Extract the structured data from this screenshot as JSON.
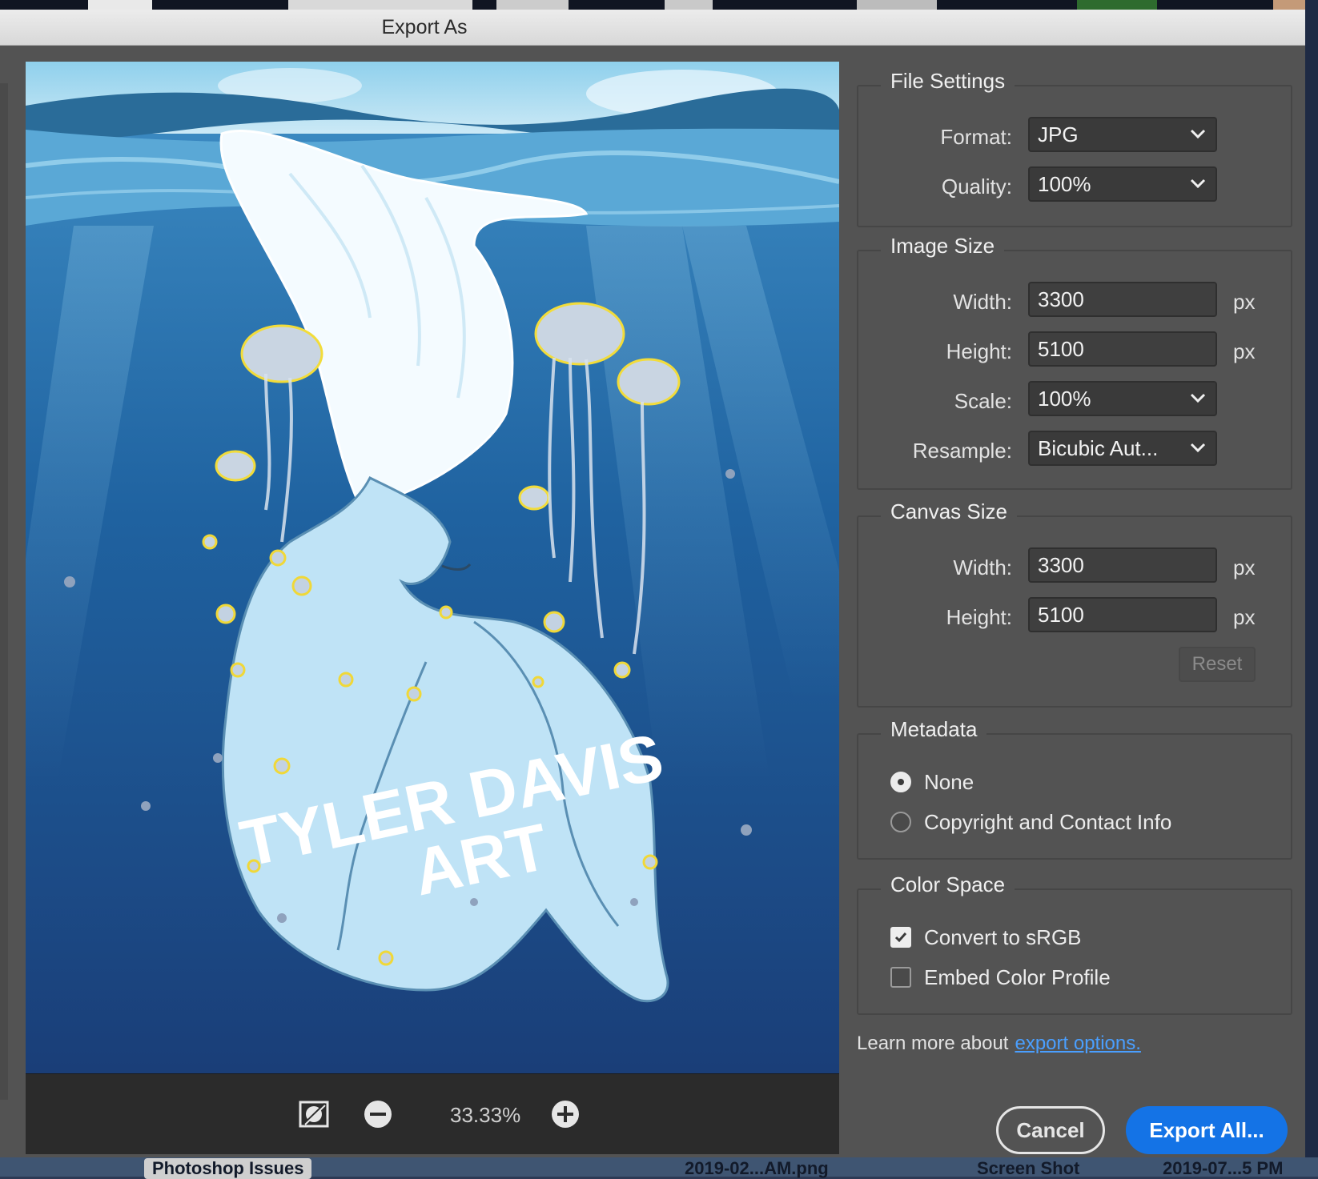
{
  "dialog": {
    "title": "Export As"
  },
  "preview": {
    "watermark_line1": "TYLER DAVIS",
    "watermark_line2": "ART",
    "zoom_level": "33.33%"
  },
  "file_settings": {
    "legend": "File Settings",
    "format_label": "Format:",
    "format_value": "JPG",
    "quality_label": "Quality:",
    "quality_value": "100%"
  },
  "image_size": {
    "legend": "Image Size",
    "width_label": "Width:",
    "width_value": "3300",
    "height_label": "Height:",
    "height_value": "5100",
    "scale_label": "Scale:",
    "scale_value": "100%",
    "resample_label": "Resample:",
    "resample_value": "Bicubic Aut...",
    "unit": "px"
  },
  "canvas_size": {
    "legend": "Canvas Size",
    "width_label": "Width:",
    "width_value": "3300",
    "height_label": "Height:",
    "height_value": "5100",
    "unit": "px",
    "reset_label": "Reset"
  },
  "metadata": {
    "legend": "Metadata",
    "options": [
      {
        "label": "None",
        "selected": true
      },
      {
        "label": "Copyright and Contact Info",
        "selected": false
      }
    ]
  },
  "color_space": {
    "legend": "Color Space",
    "convert_label": "Convert to sRGB",
    "convert_checked": true,
    "embed_label": "Embed Color Profile",
    "embed_checked": false
  },
  "learn": {
    "text": "Learn more about",
    "link": "export options."
  },
  "buttons": {
    "cancel": "Cancel",
    "export": "Export All..."
  },
  "background": {
    "taskbar_labels": [
      "Photoshop Issues",
      "2019-02...AM.png",
      "Screen Shot",
      "2019-07...5 PM"
    ]
  },
  "colors": {
    "accent": "#1473e6",
    "link": "#4a9fff",
    "panel": "#535353"
  }
}
